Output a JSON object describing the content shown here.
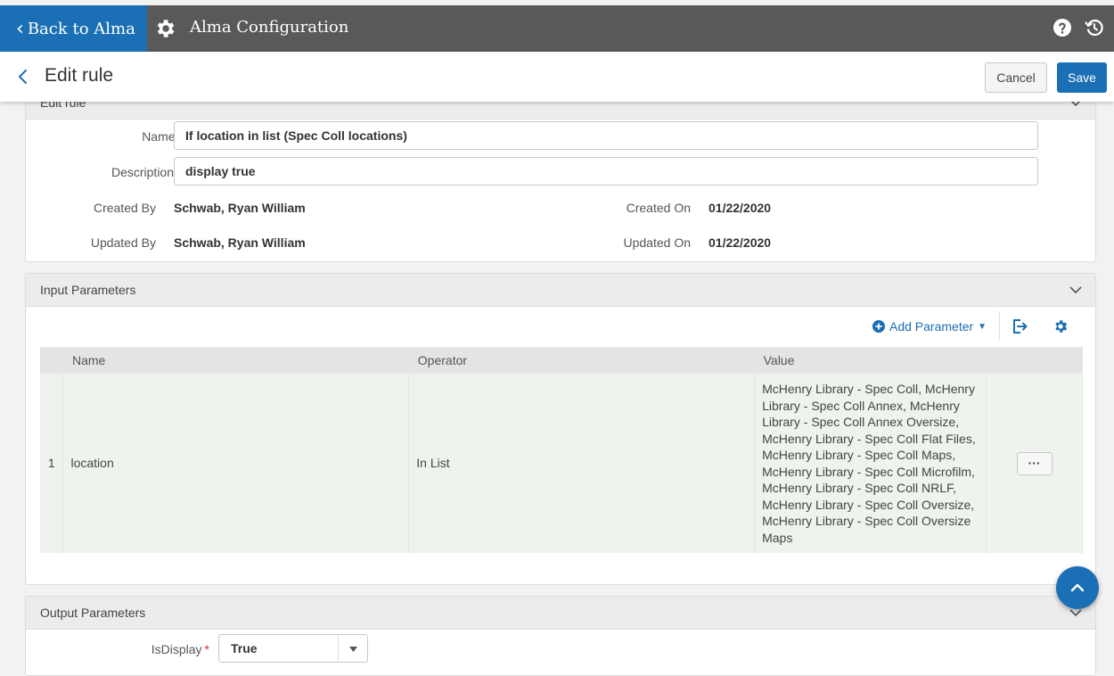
{
  "topbar": {
    "back_label": "Back to Alma",
    "app_title": "Alma Configuration",
    "icons": [
      "gear-icon",
      "help-icon",
      "history-icon"
    ]
  },
  "header": {
    "title": "Edit rule",
    "cancel_label": "Cancel",
    "save_label": "Save"
  },
  "edit_rule": {
    "section_title": "Edit rule",
    "name_label": "Name",
    "name_value": "If location in list (Spec Coll locations)",
    "description_label": "Description",
    "description_value": "display true",
    "created_by_label": "Created By",
    "created_by_value": "Schwab, Ryan William",
    "created_on_label": "Created On",
    "created_on_value": "01/22/2020",
    "updated_by_label": "Updated By",
    "updated_by_value": "Schwab, Ryan William",
    "updated_on_label": "Updated On",
    "updated_on_value": "01/22/2020"
  },
  "input_parameters": {
    "section_title": "Input Parameters",
    "add_parameter_label": "Add Parameter",
    "columns": [
      "Name",
      "Operator",
      "Value"
    ],
    "rows": [
      {
        "index": "1",
        "name": "location",
        "operator": "In List",
        "value": "McHenry Library - Spec Coll, McHenry Library - Spec Coll Annex, McHenry Library - Spec Coll Annex Oversize, McHenry Library - Spec Coll Flat Files, McHenry Library - Spec Coll Maps, McHenry Library - Spec Coll Microfilm, McHenry Library - Spec Coll NRLF, McHenry Library - Spec Coll Oversize, McHenry Library - Spec Coll Oversize Maps",
        "more_label": "···"
      }
    ]
  },
  "output_parameters": {
    "section_title": "Output Parameters",
    "isdisplay_label": "IsDisplay",
    "isdisplay_value": "True"
  },
  "colors": {
    "brand_blue": "#1b6fb5",
    "topbar_gray": "#595959",
    "required_red": "#d32f2f"
  }
}
